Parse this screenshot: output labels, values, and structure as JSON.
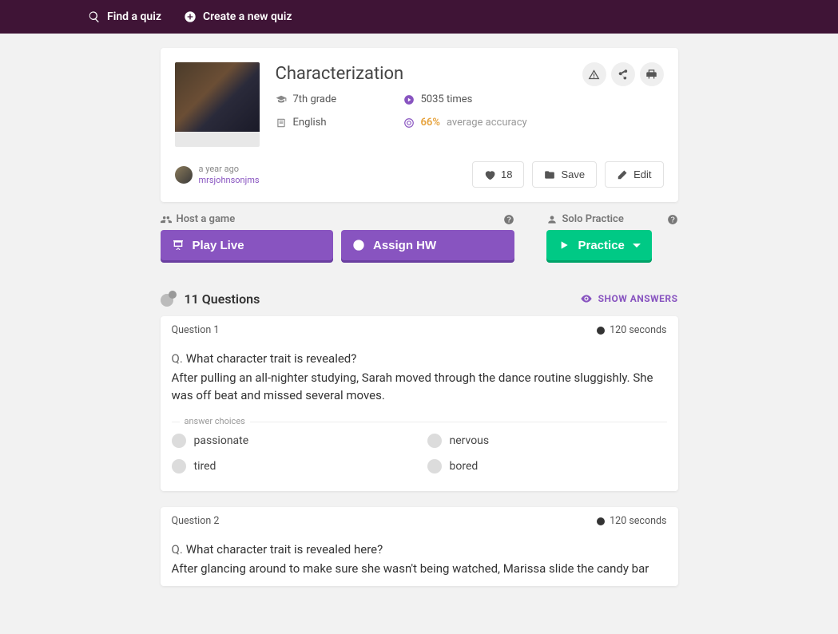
{
  "topbar": {
    "find": "Find a quiz",
    "create": "Create a new quiz"
  },
  "quiz": {
    "title": "Characterization",
    "grade": "7th grade",
    "subject": "English",
    "plays": "5035 times",
    "accuracy_value": "66%",
    "accuracy_label": "average accuracy"
  },
  "author": {
    "time": "a year ago",
    "name": "mrsjohnsonjms"
  },
  "buttons": {
    "likes": "18",
    "save": "Save",
    "edit": "Edit"
  },
  "game": {
    "host_label": "Host a game",
    "solo_label": "Solo Practice",
    "play_live": "Play Live",
    "assign_hw": "Assign HW",
    "practice": "Practice"
  },
  "questions_header": {
    "count": "11 Questions",
    "show_answers": "SHOW ANSWERS"
  },
  "choices_label": "answer choices",
  "questions": [
    {
      "number": "Question 1",
      "seconds": "120 seconds",
      "stem": "Q.",
      "prompt": "What character trait is revealed?",
      "stimulus": "After pulling an all-nighter studying, Sarah moved through the dance routine sluggishly.  She was off beat and missed several moves.",
      "choices": [
        "passionate",
        "nervous",
        "tired",
        "bored"
      ]
    },
    {
      "number": "Question 2",
      "seconds": "120 seconds",
      "stem": "Q.",
      "prompt": "What character trait is revealed here?",
      "stimulus": "After glancing around to make sure she wasn't being watched, Marissa slide the candy bar",
      "choices": []
    }
  ]
}
